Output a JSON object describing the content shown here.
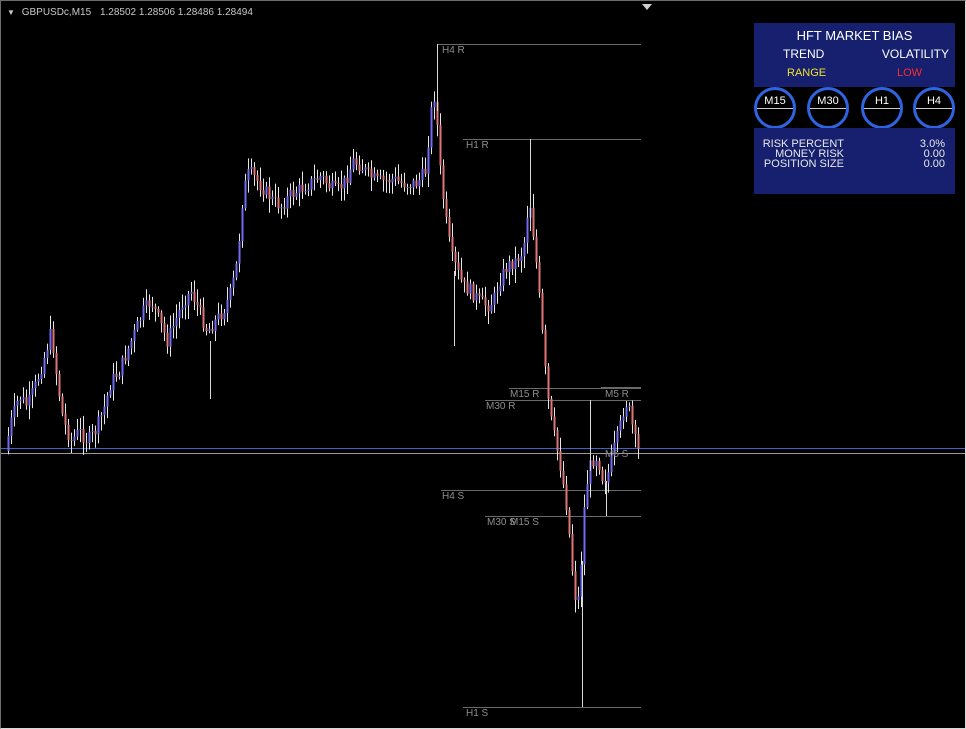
{
  "chart": {
    "symbol": "GBPUSDc,M15",
    "quote": "1.28502 1.28506 1.28486 1.28494"
  },
  "levels": {
    "h4_r": "H4 R",
    "h1_r": "H1 R",
    "m15_r": "M15 R",
    "m5_r": "M5 R",
    "m30_r": "M30 R",
    "m5_s": "M5 S",
    "h4_s": "H4 S",
    "m30_s": "M30 S",
    "m15_s": "M15 S",
    "h1_s": "H1 S"
  },
  "panel": {
    "title": "HFT MARKET BIAS",
    "trend_label": "TREND",
    "volatility_label": "VOLATILITY",
    "trend_value": "RANGE",
    "volatility_value": "LOW",
    "timeframes": [
      "M15",
      "M30",
      "H1",
      "H4"
    ],
    "risk_percent_label": "RISK PERCENT",
    "risk_percent_value": "3.0%",
    "money_risk_label": "MONEY RISK",
    "money_risk_value": "0.00",
    "position_size_label": "POSITION SIZE",
    "position_size_value": "0.00"
  },
  "colors": {
    "bull": "#6f6cf2",
    "bear": "#e07575",
    "panel_bg": "#16206e",
    "bid_line": "#3f63c9",
    "level_line": "#6a6a6a"
  }
}
